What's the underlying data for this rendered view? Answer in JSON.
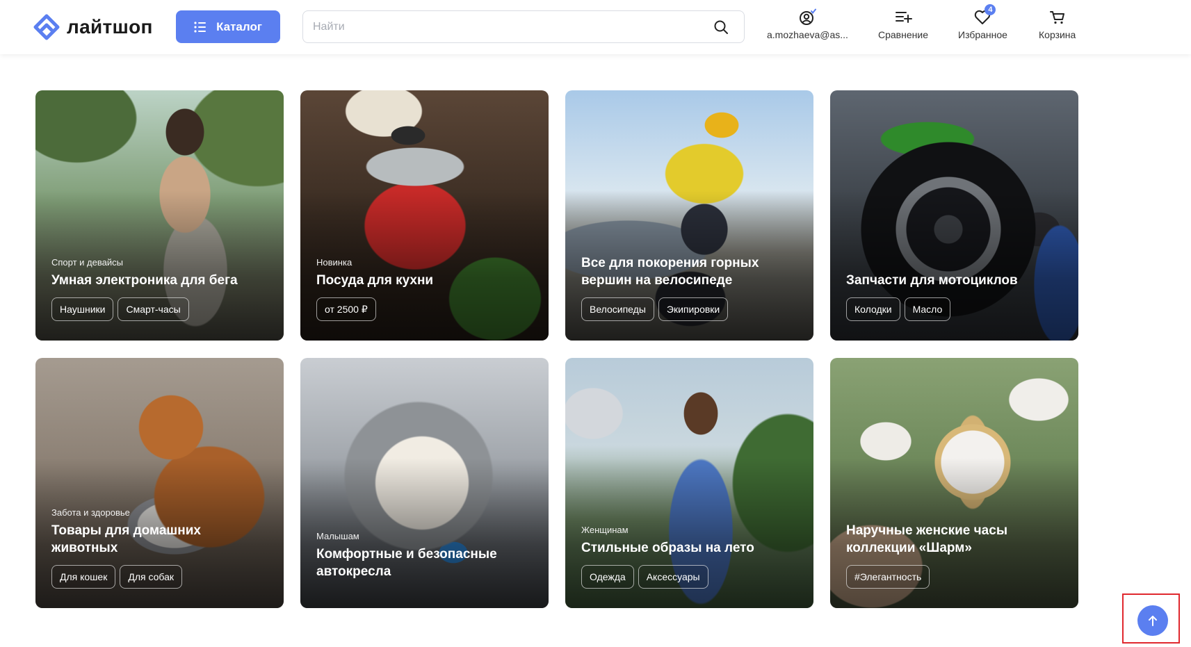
{
  "brand": {
    "name": "лайтшоп",
    "accent": "#5b7ff0"
  },
  "header": {
    "catalog_label": "Каталог",
    "search_placeholder": "Найти",
    "nav": [
      {
        "label": "a.mozhaeva@as...",
        "icon": "user-icon"
      },
      {
        "label": "Сравнение",
        "icon": "compare-icon"
      },
      {
        "label": "Избранное",
        "icon": "heart-icon",
        "badge": "4"
      },
      {
        "label": "Корзина",
        "icon": "cart-icon"
      }
    ]
  },
  "cards": [
    {
      "category": "Спорт и девайсы",
      "title": "Умная электроника для бега",
      "tags": [
        "Наушники",
        "Смарт-часы"
      ]
    },
    {
      "category": "Новинка",
      "title": "Посуда для кухни",
      "tags": [
        "от 2500 ₽"
      ]
    },
    {
      "category": "",
      "title": "Все для покорения горных вершин на велосипеде",
      "tags": [
        "Велосипеды",
        "Экипировки"
      ]
    },
    {
      "category": "",
      "title": "Запчасти для мотоциклов",
      "tags": [
        "Колодки",
        "Масло"
      ]
    },
    {
      "category": "Забота и здоровье",
      "title": "Товары для домашних животных",
      "tags": [
        "Для кошек",
        "Для собак"
      ]
    },
    {
      "category": "Малышам",
      "title": "Комфортные и безопасные автокресла",
      "tags": []
    },
    {
      "category": "Женщинам",
      "title": "Стильные образы на лето",
      "tags": [
        "Одежда",
        "Аксессуары"
      ]
    },
    {
      "category": "",
      "title": "Наручные женские часы коллекции «Шарм»",
      "tags": [
        "#Элегантность"
      ]
    }
  ]
}
